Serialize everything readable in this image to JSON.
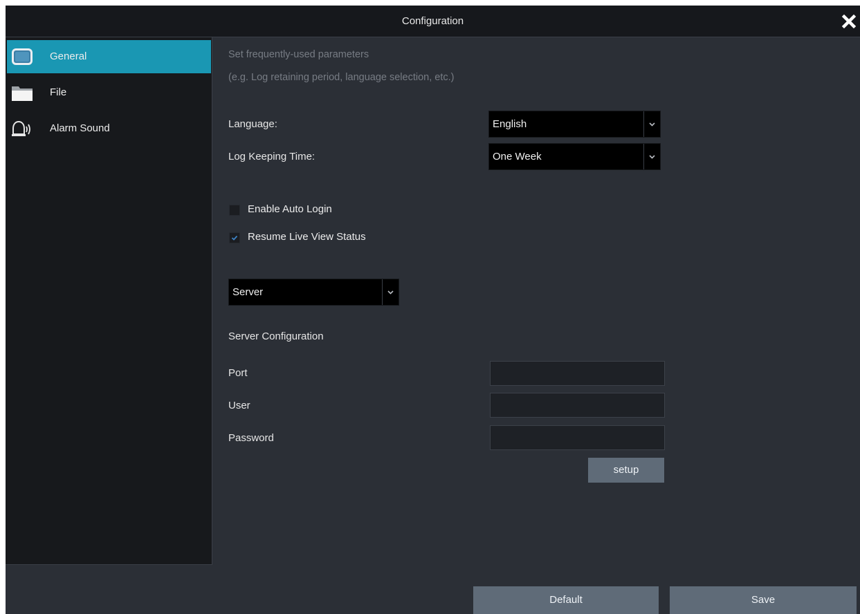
{
  "window": {
    "title": "Configuration",
    "close_icon": "close-x-icon"
  },
  "sidebar": {
    "items": [
      {
        "label": "General",
        "icon": "monitor-icon",
        "active": true
      },
      {
        "label": "File",
        "icon": "folder-icon",
        "active": false
      },
      {
        "label": "Alarm Sound",
        "icon": "alarm-bell-icon",
        "active": false
      }
    ]
  },
  "general": {
    "description_line1": "Set frequently-used parameters",
    "description_line2": "(e.g. Log retaining period, language selection, etc.)",
    "language": {
      "label": "Language:",
      "value": "English"
    },
    "log_keeping": {
      "label": "Log Keeping Time:",
      "value": "One Week"
    },
    "auto_login": {
      "label": "Enable Auto Login",
      "checked": false
    },
    "resume_live_view": {
      "label": "Resume Live View Status",
      "checked": true
    },
    "mode_select": {
      "value": "Server"
    },
    "server_config": {
      "heading": "Server Configuration",
      "port": {
        "label": "Port",
        "value": ""
      },
      "user": {
        "label": "User",
        "value": ""
      },
      "password": {
        "label": "Password",
        "value": ""
      },
      "setup_label": "setup"
    }
  },
  "footer": {
    "default_label": "Default",
    "save_label": "Save"
  },
  "colors": {
    "accent": "#1a97b3",
    "button": "#5f6b78",
    "background": "#2b2f36",
    "sidebar": "#17191c"
  }
}
